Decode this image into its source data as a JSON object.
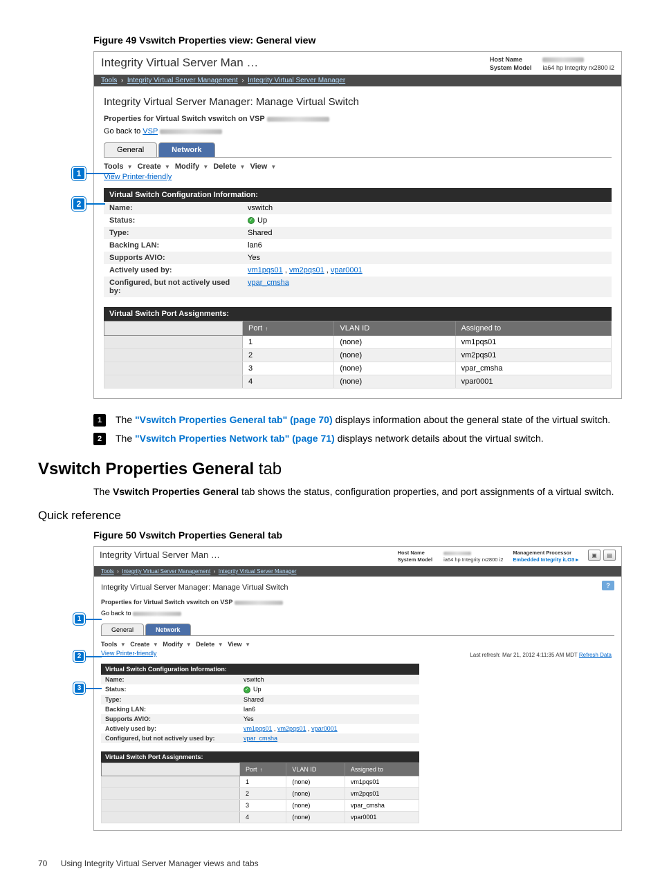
{
  "figure49": {
    "caption": "Figure 49 Vswitch Properties view: General view",
    "app_title": "Integrity Virtual Server Man …",
    "host_label": "Host Name",
    "model_label": "System Model",
    "model_value": "ia64 hp Integrity rx2800 i2",
    "breadcrumb": {
      "tools": "Tools",
      "ivsm": "Integrity Virtual Server Management",
      "ivsmgr": "Integrity Virtual Server Manager"
    },
    "page_heading": "Integrity Virtual Server Manager: Manage Virtual Switch",
    "prop_line": "Properties for Virtual Switch vswitch on VSP",
    "goback_prefix": "Go back to ",
    "goback_link": "VSP",
    "tabs": {
      "general": "General",
      "network": "Network"
    },
    "toolbar": {
      "tools": "Tools",
      "create": "Create",
      "modify": "Modify",
      "delete": "Delete",
      "view": "View"
    },
    "printer": "View Printer-friendly",
    "config_hdr": "Virtual Switch Configuration Information:",
    "kv": {
      "name_l": "Name:",
      "name_v": "vswitch",
      "status_l": "Status:",
      "status_v": "Up",
      "type_l": "Type:",
      "type_v": "Shared",
      "lan_l": "Backing LAN:",
      "lan_v": "lan6",
      "avio_l": "Supports AVIO:",
      "avio_v": "Yes",
      "used_l": "Actively used by:",
      "used_links": [
        "vm1pqs01",
        "vm2pqs01",
        "vpar0001"
      ],
      "cfg_l": "Configured, but not actively used by:",
      "cfg_link": "vpar_cmsha"
    },
    "ports_hdr": "Virtual Switch Port Assignments:",
    "port_cols": {
      "port": "Port",
      "vlan": "VLAN ID",
      "assigned": "Assigned to"
    },
    "ports": [
      {
        "p": "1",
        "v": "(none)",
        "a": "vm1pqs01"
      },
      {
        "p": "2",
        "v": "(none)",
        "a": "vm2pqs01"
      },
      {
        "p": "3",
        "v": "(none)",
        "a": "vpar_cmsha"
      },
      {
        "p": "4",
        "v": "(none)",
        "a": "vpar0001"
      }
    ]
  },
  "notes": {
    "n1_pre": "The ",
    "n1_link": "\"Vswitch Properties General tab\" (page 70)",
    "n1_post": " displays information about the general state of the virtual switch.",
    "n2_pre": "The ",
    "n2_link": "\"Vswitch Properties Network tab\" (page 71)",
    "n2_post": " displays network details about the virtual switch."
  },
  "section": {
    "heading_bold": "Vswitch Properties General",
    "heading_tail": " tab",
    "body_pre": "The ",
    "body_bold": "Vswitch Properties General",
    "body_post": " tab shows the status, configuration properties, and port assignments of a virtual switch.",
    "quickref": "Quick reference"
  },
  "figure50": {
    "caption": "Figure 50 Vswitch Properties General tab",
    "mp_label": "Management Processor",
    "mp_value": "Embedded Integrity iLO3",
    "refresh": "Last refresh: Mar 21, 2012 4:11:35 AM MDT ",
    "refresh_link": "Refresh Data"
  },
  "footer": {
    "page": "70",
    "text": "Using Integrity Virtual Server Manager views and tabs"
  }
}
